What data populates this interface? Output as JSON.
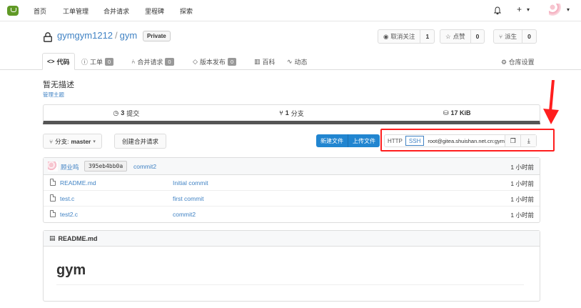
{
  "topnav": {
    "items": [
      "首页",
      "工单管理",
      "合并请求",
      "里程碑",
      "探索"
    ],
    "plus": "+",
    "caret": "▾"
  },
  "repo": {
    "owner": "gymgym1212",
    "separator": "/",
    "name": "gym",
    "visibility": "Private",
    "actions": [
      {
        "label": "取消关注",
        "count": "1",
        "icon": "eye-slash-icon"
      },
      {
        "label": "点赞",
        "count": "0",
        "icon": "star-icon"
      },
      {
        "label": "派生",
        "count": "0",
        "icon": "fork-icon"
      }
    ],
    "tabs": [
      {
        "label": "代码",
        "num": ""
      },
      {
        "label": "工单",
        "num": "0"
      },
      {
        "label": "合并请求",
        "num": "0"
      },
      {
        "label": "版本发布",
        "num": "0"
      },
      {
        "label": "百科",
        "num": ""
      },
      {
        "label": "动态",
        "num": ""
      }
    ],
    "settings": "仓库设置"
  },
  "main": {
    "description": "暂无描述",
    "manage_topics": "管理主题",
    "stats": [
      {
        "value": "3",
        "label": "提交"
      },
      {
        "value": "1",
        "label": "分支"
      },
      {
        "value": "17 KiB",
        "label": ""
      }
    ],
    "branch": {
      "prefix": "分支:",
      "name": "master"
    },
    "new_pr": "创建合并请求",
    "new_file": "新建文件",
    "upload_file": "上传文件",
    "clone": {
      "http": "HTTP",
      "ssh": "SSH",
      "url": "root@gitea.shuishan.net.cn:gym",
      "selected": "SSH"
    }
  },
  "latest_commit": {
    "author": "顾业鸣",
    "sha": "395eb4bb0a",
    "message": "commit2",
    "time": "1 小时前"
  },
  "files": [
    {
      "name": "README.md",
      "message": "Initial commit",
      "time": "1 小时前"
    },
    {
      "name": "test.c",
      "message": "first commit",
      "time": "1 小时前"
    },
    {
      "name": "test2.c",
      "message": "commit2",
      "time": "1 小时前"
    }
  ],
  "readme": {
    "filename": "README.md",
    "heading": "gym"
  },
  "colors": {
    "brand": "#609926",
    "link": "#4183c4",
    "primary": "#2185d0",
    "highlight": "#ff1e1e"
  }
}
